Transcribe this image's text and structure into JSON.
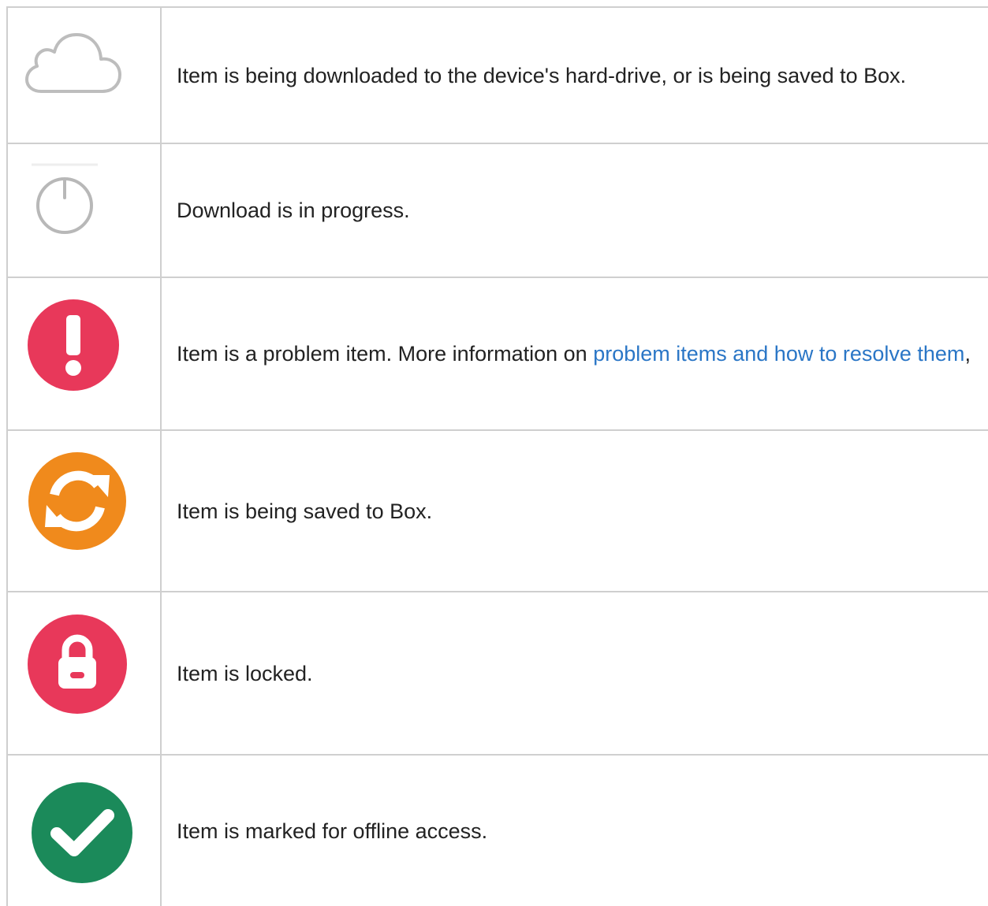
{
  "rows": [
    {
      "icon": "cloud-outline-icon",
      "text": "Item is being downloaded to the device's hard-drive, or is being saved to Box."
    },
    {
      "icon": "progress-clock-icon",
      "text": "Download is in progress."
    },
    {
      "icon": "exclamation-circle-icon",
      "text_before": "Item is a problem item. More information on ",
      "link": "problem items and how to resolve them",
      "text_after": ",",
      "color": "#e8385a"
    },
    {
      "icon": "sync-icon",
      "text": "Item is being saved to Box.",
      "color": "#f08a1c"
    },
    {
      "icon": "lock-icon",
      "text": "Item is locked.",
      "color": "#e8385a"
    },
    {
      "icon": "check-circle-icon",
      "text": "Item is marked for offline access.",
      "color": "#1b8a5a"
    }
  ]
}
